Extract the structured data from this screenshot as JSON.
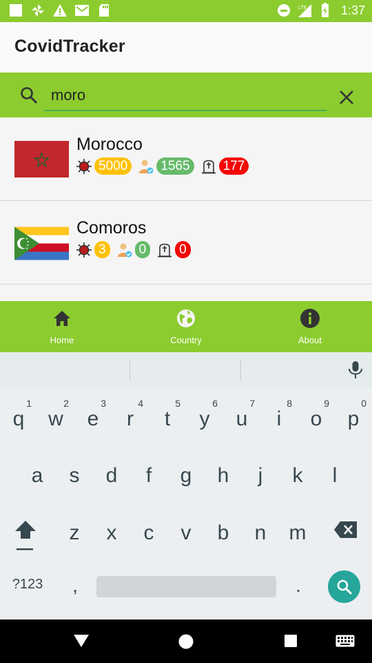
{
  "status_bar": {
    "time": "1:37",
    "network": "LTE",
    "left_icons": [
      "square-icon",
      "pinwheel-icon",
      "warning-icon",
      "mail-icon",
      "sd-card-icon"
    ],
    "right_icons": [
      "do-not-disturb-icon",
      "signal-icon",
      "battery-icon"
    ]
  },
  "app": {
    "title": "CovidTracker"
  },
  "search": {
    "value": "moro",
    "placeholder": ""
  },
  "results": [
    {
      "country": "Morocco",
      "cases": "5000",
      "recovered": "1565",
      "deaths": "177"
    },
    {
      "country": "Comoros",
      "cases": "3",
      "recovered": "0",
      "deaths": "0"
    }
  ],
  "bottom_nav": [
    {
      "label": "Home",
      "icon": "home-icon"
    },
    {
      "label": "Country",
      "icon": "globe-icon"
    },
    {
      "label": "About",
      "icon": "info-icon"
    }
  ],
  "keyboard": {
    "row1": [
      [
        "q",
        "1"
      ],
      [
        "w",
        "2"
      ],
      [
        "e",
        "3"
      ],
      [
        "r",
        "4"
      ],
      [
        "t",
        "5"
      ],
      [
        "y",
        "6"
      ],
      [
        "u",
        "7"
      ],
      [
        "i",
        "8"
      ],
      [
        "o",
        "9"
      ],
      [
        "p",
        "0"
      ]
    ],
    "row2": [
      "a",
      "s",
      "d",
      "f",
      "g",
      "h",
      "j",
      "k",
      "l"
    ],
    "row3": [
      "z",
      "x",
      "c",
      "v",
      "b",
      "n",
      "m"
    ],
    "symbols_label": "?123",
    "comma": ",",
    "period": "."
  },
  "colors": {
    "primary": "#8ccc2f",
    "cases_badge": "#ffc107",
    "recovered_badge": "#66bb6a",
    "deaths_badge": "#f40606",
    "search_key": "#26a69a"
  }
}
